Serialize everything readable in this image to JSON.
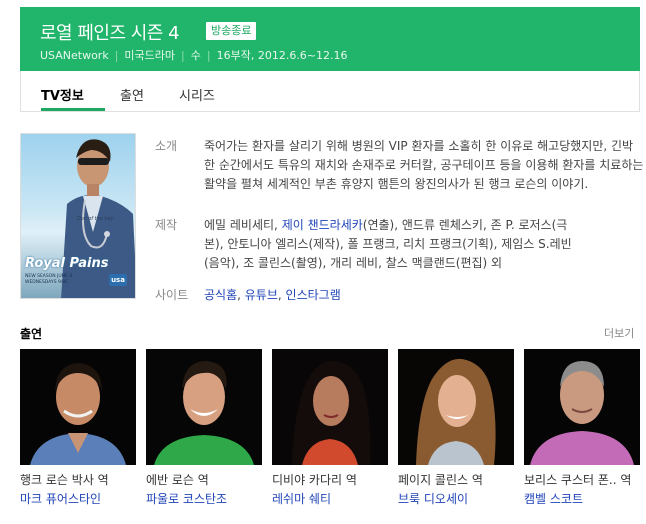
{
  "header": {
    "title": "로열 페인즈 시즌 4",
    "badge": "방송종료",
    "meta": [
      "USANetwork",
      "미국드라마",
      "수",
      "16부작, 2012.6.6~12.16"
    ],
    "bg_color": "#20b56a"
  },
  "tabs": [
    {
      "label": "TV정보",
      "active": true
    },
    {
      "label": "출연",
      "active": false
    },
    {
      "label": "시리즈",
      "active": false
    }
  ],
  "poster": {
    "tagline": "Doc of the bay",
    "logo_text": "Royal Pains",
    "sub_text": "NEW SEASON JUNE 6 WEDNESDAYS 9/8C",
    "network": "usa"
  },
  "info": {
    "synopsis_label": "소개",
    "synopsis": "죽어가는 환자를 살리기 위해 병원의 VIP 환자를 소홀히 한 이유로 해고당했지만, 긴박한 순간에서도 특유의 재치와 손재주로 커터칼, 공구테이프 등을 이용해 환자를 치료하는 활약을 펼쳐 세계적인 부촌 휴양지 햄튼의 왕진의사가 된 행크 로슨의 이야기.",
    "production_label": "제작",
    "production_lines": [
      {
        "pre": "에밀 레비세티, ",
        "link": "제이 챈드라세카",
        "post": "(연출), 앤드류 렌체스키, 존 P. 로저스(극"
      },
      {
        "pre": "본), 안토니아 엘리스(제작), 폴 프랭크, 리치 프랭크(기획), 제임스 S.레빈",
        "link": "",
        "post": ""
      },
      {
        "pre": "(음악), 조 콜린스(촬영), 개리 레비, 찰스 맥클랜드(편집) 외",
        "link": "",
        "post": ""
      }
    ],
    "site_label": "사이트",
    "sites": [
      "공식홈",
      "유튜브",
      "인스타그램"
    ],
    "site_sep": ", "
  },
  "cast_section": {
    "title": "출연",
    "more": "더보기"
  },
  "cast": [
    {
      "role": "행크 로슨 박사 역",
      "actor": "마크 퓨어스타인"
    },
    {
      "role": "에반 로슨 역",
      "actor": "파울로 코스탄조"
    },
    {
      "role": "디비야 카다리 역",
      "actor": "레쉬마 쉐티"
    },
    {
      "role": "페이지 콜린스 역",
      "actor": "브룩 디오세이"
    },
    {
      "role": "보리스 쿠스터 폰.. 역",
      "actor": "캠벨 스코트"
    }
  ]
}
